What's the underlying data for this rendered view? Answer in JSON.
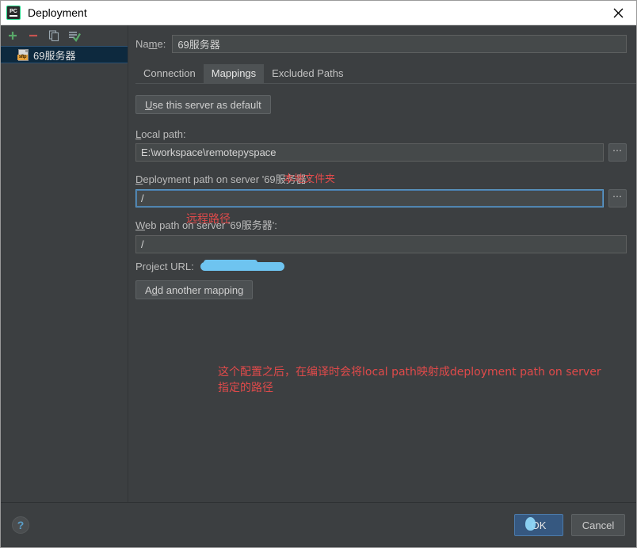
{
  "window": {
    "title": "Deployment",
    "app_icon": "pycharm-logo-icon",
    "close_icon": "close-icon"
  },
  "sidebar": {
    "toolbar": [
      {
        "name": "add-button",
        "icon": "plus-icon",
        "label": "+"
      },
      {
        "name": "remove-button",
        "icon": "minus-icon",
        "label": "−"
      },
      {
        "name": "copy-button",
        "icon": "copy-icon",
        "label": ""
      },
      {
        "name": "set-default-button",
        "icon": "check-icon",
        "label": ""
      }
    ],
    "items": [
      {
        "label": "69服务器",
        "icon": "sftp-file-icon",
        "selected": true
      }
    ]
  },
  "form": {
    "name_label": "Name:",
    "name_mnemonic": "m",
    "name_value": "69服务器",
    "tabs": [
      {
        "label": "Connection",
        "active": false
      },
      {
        "label": "Mappings",
        "active": true
      },
      {
        "label": "Excluded Paths",
        "active": false
      }
    ],
    "use_default_button": "Use this server as default",
    "use_default_mnemonic": "U",
    "local_path_label": "Local path:",
    "local_path_value": "E:\\workspace\\remotepyspace",
    "deployment_path_label": "Deployment path on server '69服务器':",
    "deployment_path_value": "/",
    "web_path_label": "Web path on server '69服务器':",
    "web_path_value": "/",
    "project_url_label": "Project URL:",
    "project_url_value": "",
    "add_mapping_button": "Add another mapping",
    "browse_button_label": "…"
  },
  "annotations": {
    "local_path": "本地文件夹",
    "remote_path": "远程路径",
    "note_line1": "这个配置之后，在编译时会将local path映射成deployment path on server",
    "note_line2": "指定的路径",
    "color": "#e04a4a"
  },
  "footer": {
    "help_label": "?",
    "ok_label": "OK",
    "cancel_label": "Cancel"
  },
  "colors": {
    "window_bg": "#3c3f41",
    "field_bg": "#45494a",
    "selection_bg": "#0d293e",
    "accent_blue": "#365880",
    "focus_border": "#5c9ccc",
    "redaction": "#6ec4f0",
    "annotation_red": "#e04a4a",
    "titlebar_bg": "#ffffff"
  }
}
